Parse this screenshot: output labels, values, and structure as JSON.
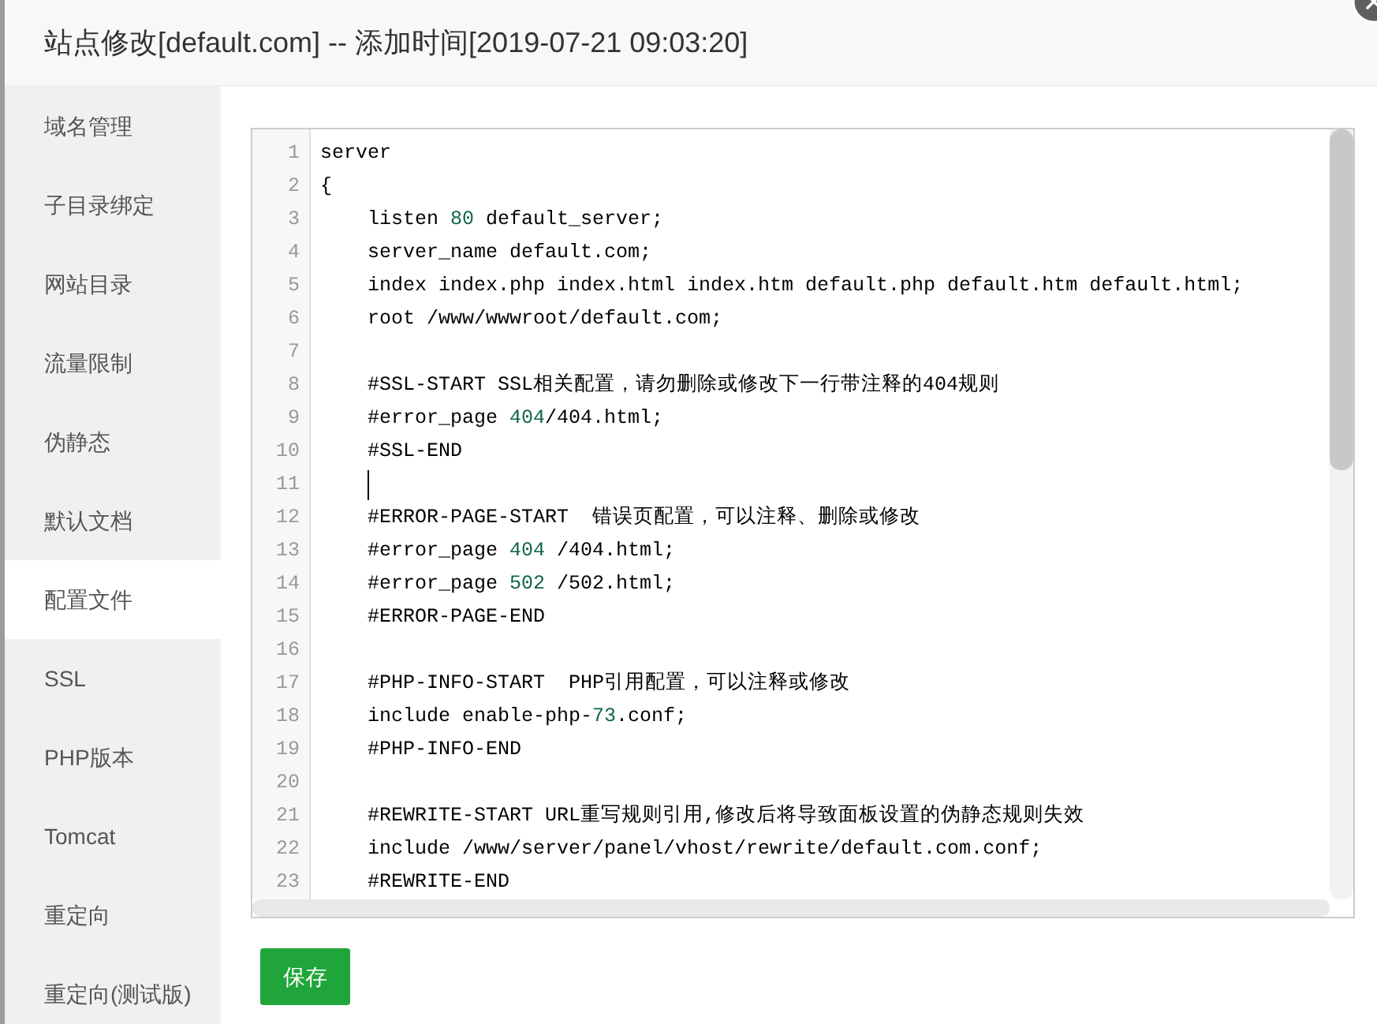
{
  "dialog": {
    "title": "站点修改[default.com] -- 添加时间[2019-07-21 09:03:20]"
  },
  "sidebar": {
    "items": [
      {
        "label": "域名管理",
        "selected": false
      },
      {
        "label": "子目录绑定",
        "selected": false
      },
      {
        "label": "网站目录",
        "selected": false
      },
      {
        "label": "流量限制",
        "selected": false
      },
      {
        "label": "伪静态",
        "selected": false
      },
      {
        "label": "默认文档",
        "selected": false
      },
      {
        "label": "配置文件",
        "selected": true
      },
      {
        "label": "SSL",
        "selected": false
      },
      {
        "label": "PHP版本",
        "selected": false
      },
      {
        "label": "Tomcat",
        "selected": false
      },
      {
        "label": "重定向",
        "selected": false
      },
      {
        "label": "重定向(测试版)",
        "selected": false
      }
    ]
  },
  "editor": {
    "lines": [
      {
        "number": "1",
        "parts": [
          {
            "text": "server",
            "kind": "plain"
          }
        ]
      },
      {
        "number": "2",
        "parts": [
          {
            "text": "{",
            "kind": "plain"
          }
        ],
        "children": [
          {
            "number": "3",
            "parts": [
              {
                "text": "listen ",
                "kind": "plain"
              },
              {
                "text": "80",
                "kind": "number"
              },
              {
                "text": " default_server;",
                "kind": "plain"
              }
            ]
          },
          {
            "number": "4",
            "parts": [
              {
                "text": "server_name default.com;",
                "kind": "plain"
              }
            ]
          },
          {
            "number": "5",
            "parts": [
              {
                "text": "index index.php index.html index.htm default.php default.htm default.html;",
                "kind": "plain"
              }
            ]
          },
          {
            "number": "6",
            "parts": [
              {
                "text": "root /www/wwwroot/default.com;",
                "kind": "plain"
              }
            ]
          },
          {
            "number": "7"
          },
          {
            "number": "8",
            "parts": [
              {
                "text": "#SSL-START SSL相关配置，请勿删除或修改下一行带注释的404规则",
                "kind": "plain"
              }
            ]
          },
          {
            "number": "9",
            "parts": [
              {
                "text": "#error_page ",
                "kind": "plain"
              },
              {
                "text": "404",
                "kind": "number"
              },
              {
                "text": "/404.html;",
                "kind": "plain"
              }
            ]
          },
          {
            "number": "10",
            "parts": [
              {
                "text": "#SSL-END",
                "kind": "plain"
              }
            ]
          },
          {
            "number": "11",
            "cursor": true
          },
          {
            "number": "12",
            "parts": [
              {
                "text": "#ERROR-PAGE-START  错误页配置，可以注释、删除或修改",
                "kind": "plain"
              }
            ]
          },
          {
            "number": "13",
            "parts": [
              {
                "text": "#error_page ",
                "kind": "plain"
              },
              {
                "text": "404",
                "kind": "number"
              },
              {
                "text": " /404.html;",
                "kind": "plain"
              }
            ]
          },
          {
            "number": "14",
            "parts": [
              {
                "text": "#error_page ",
                "kind": "plain"
              },
              {
                "text": "502",
                "kind": "number"
              },
              {
                "text": " /502.html;",
                "kind": "plain"
              }
            ]
          },
          {
            "number": "15",
            "parts": [
              {
                "text": "#ERROR-PAGE-END",
                "kind": "plain"
              }
            ]
          },
          {
            "number": "16"
          },
          {
            "number": "17",
            "parts": [
              {
                "text": "#PHP-INFO-START  PHP引用配置，可以注释或修改",
                "kind": "plain"
              }
            ]
          },
          {
            "number": "18",
            "parts": [
              {
                "text": "include enable-php-",
                "kind": "plain"
              },
              {
                "text": "73",
                "kind": "number"
              },
              {
                "text": ".conf;",
                "kind": "plain"
              }
            ]
          },
          {
            "number": "19",
            "parts": [
              {
                "text": "#PHP-INFO-END",
                "kind": "plain"
              }
            ]
          },
          {
            "number": "20"
          },
          {
            "number": "21",
            "parts": [
              {
                "text": "#REWRITE-START URL重写规则引用,修改后将导致面板设置的伪静态规则失效",
                "kind": "plain"
              }
            ]
          },
          {
            "number": "22",
            "parts": [
              {
                "text": "include /www/server/panel/vhost/rewrite/default.com.conf;",
                "kind": "plain"
              }
            ]
          },
          {
            "number": "23",
            "parts": [
              {
                "text": "#REWRITE-END",
                "kind": "plain"
              }
            ]
          }
        ]
      }
    ]
  },
  "save_button": {
    "label": "保存"
  }
}
